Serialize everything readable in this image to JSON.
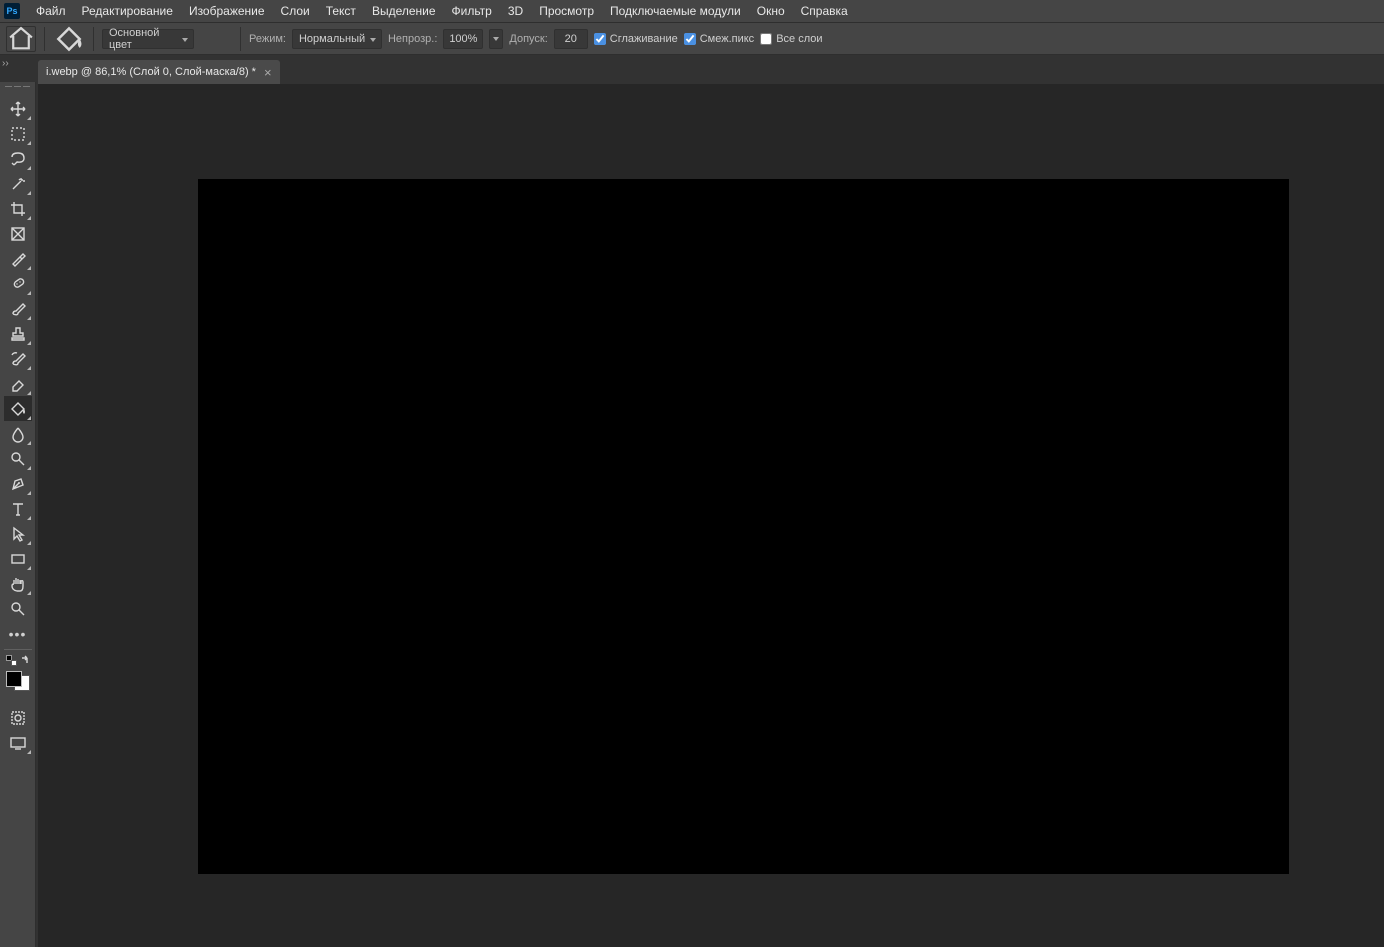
{
  "menu": {
    "items": [
      "Файл",
      "Редактирование",
      "Изображение",
      "Слои",
      "Текст",
      "Выделение",
      "Фильтр",
      "3D",
      "Просмотр",
      "Подключаемые модули",
      "Окно",
      "Справка"
    ]
  },
  "options": {
    "fill_source_label": "Основной цвет",
    "mode_label": "Режим:",
    "mode_value": "Нормальный",
    "opacity_label": "Непрозр.:",
    "opacity_value": "100%",
    "tolerance_label": "Допуск:",
    "tolerance_value": "20",
    "antialias_label": "Сглаживание",
    "antialias_checked": true,
    "contiguous_label": "Смеж.пикс",
    "contiguous_checked": true,
    "all_layers_label": "Все слои",
    "all_layers_checked": false
  },
  "document": {
    "tab_title": "i.webp @ 86,1% (Слой 0, Слой-маска/8) *"
  },
  "tools": [
    {
      "name": "move-tool",
      "sub": true
    },
    {
      "name": "marquee-tool",
      "sub": true
    },
    {
      "name": "lasso-tool",
      "sub": true
    },
    {
      "name": "magic-wand-tool",
      "sub": true
    },
    {
      "name": "crop-tool",
      "sub": true
    },
    {
      "name": "frame-tool",
      "sub": false
    },
    {
      "name": "eyedropper-tool",
      "sub": true
    },
    {
      "name": "spot-healing-tool",
      "sub": true
    },
    {
      "name": "brush-tool",
      "sub": true
    },
    {
      "name": "clone-stamp-tool",
      "sub": true
    },
    {
      "name": "history-brush-tool",
      "sub": true
    },
    {
      "name": "eraser-tool",
      "sub": true
    },
    {
      "name": "paint-bucket-tool",
      "sub": true,
      "active": true
    },
    {
      "name": "blur-tool",
      "sub": true
    },
    {
      "name": "dodge-tool",
      "sub": true
    },
    {
      "name": "pen-tool",
      "sub": true
    },
    {
      "name": "type-tool",
      "sub": true
    },
    {
      "name": "path-selection-tool",
      "sub": true
    },
    {
      "name": "rectangle-tool",
      "sub": true
    },
    {
      "name": "hand-tool",
      "sub": true
    },
    {
      "name": "zoom-tool",
      "sub": false
    }
  ],
  "logo": "Ps"
}
